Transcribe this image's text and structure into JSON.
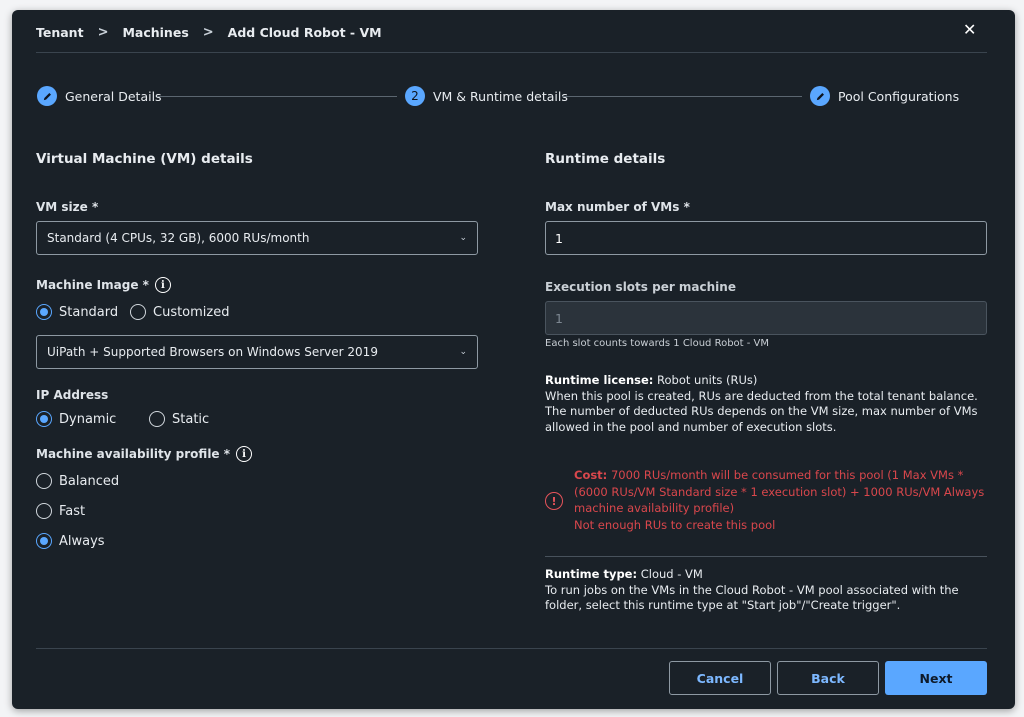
{
  "breadcrumb": [
    "Tenant",
    "Machines",
    "Add Cloud Robot - VM"
  ],
  "breadcrumb_sep": ">",
  "close_glyph": "✕",
  "steps": [
    {
      "label": "General Details",
      "icon": "pencil-icon"
    },
    {
      "label": "VM & Runtime details",
      "number": "2"
    },
    {
      "label": "Pool Configurations",
      "icon": "pencil-icon"
    }
  ],
  "vm_section": {
    "title": "Virtual Machine (VM) details",
    "vm_size_label": "VM size *",
    "vm_size_value": "Standard (4 CPUs, 32 GB), 6000 RUs/month",
    "image_label": "Machine Image *",
    "image_options": [
      "Standard",
      "Customized"
    ],
    "image_selected": "Standard",
    "image_value": "UiPath + Supported Browsers on Windows Server 2019",
    "ip_label": "IP Address",
    "ip_options": [
      "Dynamic",
      "Static"
    ],
    "ip_selected": "Dynamic",
    "availability_label": "Machine availability profile *",
    "availability_options": [
      "Balanced",
      "Fast",
      "Always"
    ],
    "availability_selected": "Always"
  },
  "runtime_section": {
    "title": "Runtime details",
    "max_vms_label": "Max number of VMs *",
    "max_vms_value": "1",
    "slots_label": "Execution slots per machine",
    "slots_value": "1",
    "slots_help": "Each slot counts towards 1 Cloud Robot - VM",
    "license_label": "Runtime license:",
    "license_value": "Robot units (RUs)",
    "license_desc": "When this pool is created, RUs are deducted from the total tenant balance. The number of deducted RUs depends on the VM size, max number of VMs allowed in the pool and number of execution slots.",
    "cost_label": "Cost:",
    "cost_text": "7000 RUs/month will be consumed for this pool (1 Max VMs * (6000 RUs/VM Standard size * 1 execution slot) + 1000 RUs/VM Always machine availability profile)",
    "cost_error": "Not enough RUs to create this pool",
    "runtime_type_label": "Runtime type:",
    "runtime_type_value": "Cloud - VM",
    "runtime_type_desc": "To run jobs on the VMs in the Cloud Robot - VM pool associated with the folder, select this runtime type at \"Start job\"/\"Create trigger\"."
  },
  "footer": {
    "cancel": "Cancel",
    "back": "Back",
    "next": "Next"
  },
  "colors": {
    "accent": "#5aa7ff",
    "error": "#d9474c",
    "background": "#1a2128"
  }
}
